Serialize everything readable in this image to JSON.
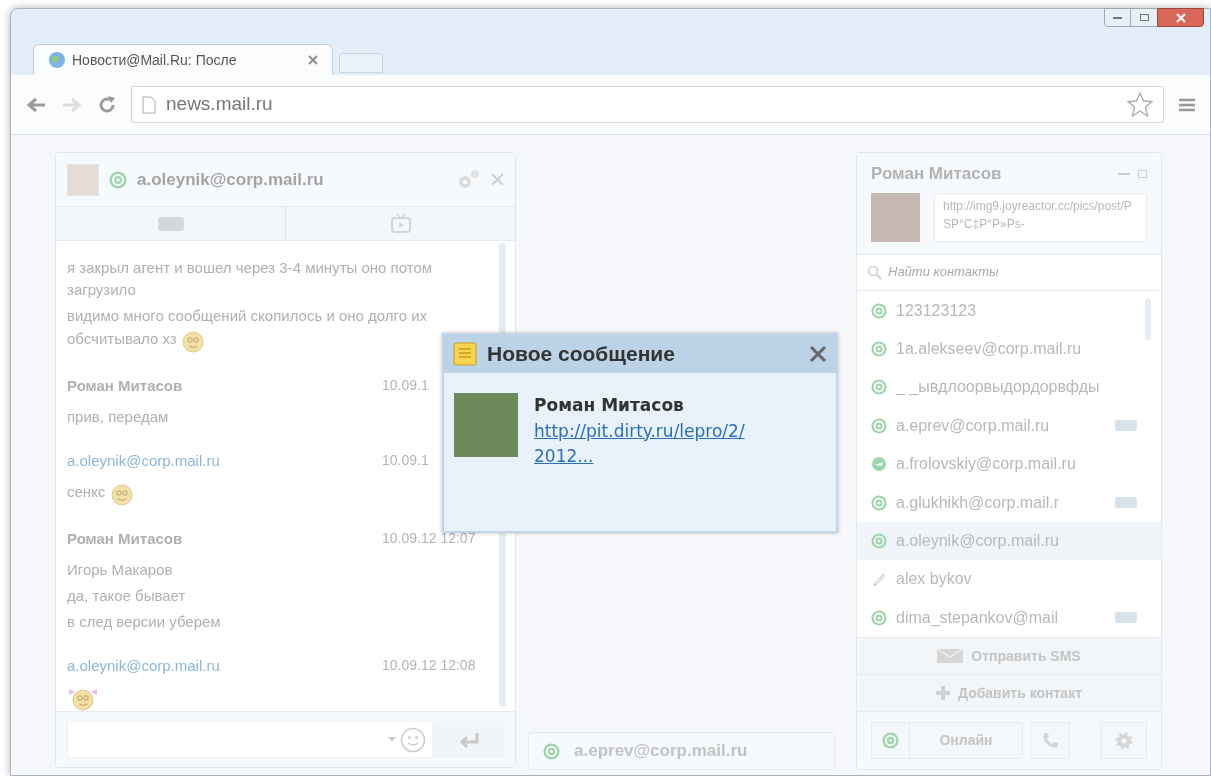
{
  "browser": {
    "tab_title": "Новости@Mail.Ru: После",
    "url": "news.mail.ru",
    "forward_disabled": true
  },
  "chat": {
    "contact": "a.oleynik@corp.mail.ru",
    "messages": [
      {
        "lines": [
          "я закрыл агент и вошел через 3-4 минуты оно потом загрузило",
          "видимо много сообщений скопилось и оно долго их обсчитывало хз"
        ],
        "emoticon": {
          "kind": "plain"
        }
      },
      {
        "author": "Роман Митасов",
        "self": false,
        "time": "10.09.1",
        "lines": [
          "прив, передам"
        ]
      },
      {
        "author": "a.oleynik@corp.mail.ru",
        "self": true,
        "time": "10.09.1",
        "lines": [
          "сенкс"
        ],
        "emoticon": {
          "kind": "plain"
        }
      },
      {
        "author": "Роман Митасов",
        "self": false,
        "time": "10.09.12 12:07",
        "lines": [
          "Игорь Макаров",
          "да, такое бывает",
          "в след версии уберем"
        ]
      },
      {
        "author": "a.oleynik@corp.mail.ru",
        "self": true,
        "time": "10.09.12 12:08",
        "emoticon": {
          "kind": "bow"
        }
      }
    ]
  },
  "popup": {
    "title": "Новое сообщение",
    "sender": "Роман Митасов",
    "link": "http://pit.dirty.ru/lepro/2/ 2012..."
  },
  "minimized_chat": {
    "contact": "a.eprev@corp.mail.ru"
  },
  "contacts": {
    "owner": "Роман Митасов",
    "status_text": "http://img9.joyreactor.cc/pics/post/PSP°C‡P°P»Ps-",
    "search": {
      "placeholder": "Найти контакты"
    },
    "items": [
      {
        "kind": "mail",
        "name": "123123123",
        "sms": false,
        "selected": false
      },
      {
        "kind": "mail",
        "name": "1a.alekseev@corp.mail.ru",
        "sms": false,
        "selected": false
      },
      {
        "kind": "mail",
        "name": "_ _ывдлоорвыдордорвфды",
        "sms": false,
        "selected": false
      },
      {
        "kind": "mail",
        "name": "a.eprev@corp.mail.ru",
        "sms": true,
        "selected": false
      },
      {
        "kind": "bubble",
        "name": "a.frolovskiy@corp.mail.ru",
        "sms": false,
        "selected": false
      },
      {
        "kind": "mail",
        "name": "a.glukhikh@corp.mail.r",
        "sms": true,
        "selected": false
      },
      {
        "kind": "mail",
        "name": "a.oleynik@corp.mail.ru",
        "sms": false,
        "selected": true
      },
      {
        "kind": "pencil",
        "name": "alex bykov",
        "sms": false,
        "selected": false
      },
      {
        "kind": "mail",
        "name": "dima_stepankov@mail",
        "sms": true,
        "selected": false
      }
    ],
    "send_sms": "Отправить SMS",
    "add_contact": "Добавить контакт",
    "status": "Онлайн"
  }
}
